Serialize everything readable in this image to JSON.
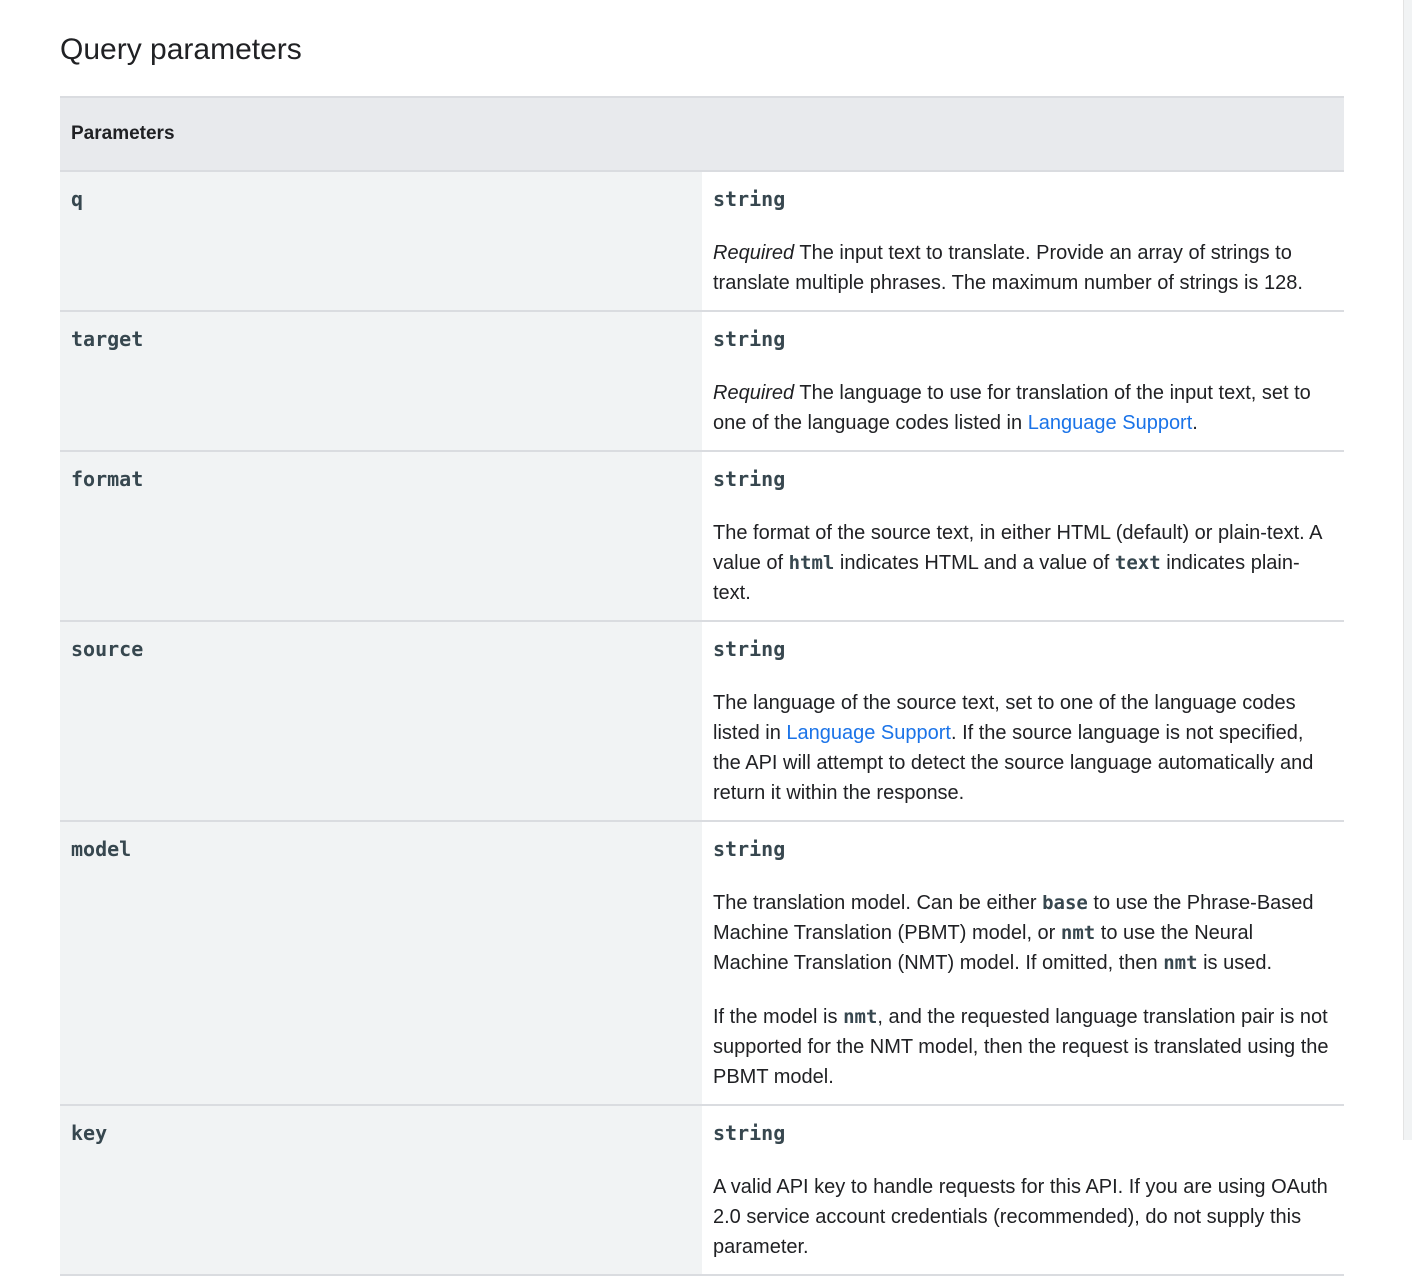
{
  "page": {
    "title": "Query parameters"
  },
  "table": {
    "header": "Parameters"
  },
  "params": {
    "q": {
      "name": "q",
      "type": "string",
      "required": "Required",
      "desc": " The input text to translate. Provide an array of strings to translate multiple phrases. The maximum number of strings is 128."
    },
    "target": {
      "name": "target",
      "type": "string",
      "required": "Required",
      "desc_1": " The language to use for translation of the input text, set to one of the language codes listed in ",
      "link": "Language Support",
      "desc_2": "."
    },
    "format": {
      "name": "format",
      "type": "string",
      "desc_1": "The format of the source text, in either HTML (default) or plain-text. A value of ",
      "code_1": "html",
      "desc_2": " indicates HTML and a value of ",
      "code_2": "text",
      "desc_3": " indicates plain-text."
    },
    "source": {
      "name": "source",
      "type": "string",
      "desc_1": "The language of the source text, set to one of the language codes listed in ",
      "link": "Language Support",
      "desc_2": ". If the source language is not specified, the API will attempt to detect the source language automatically and return it within the response."
    },
    "model": {
      "name": "model",
      "type": "string",
      "p1_1": "The translation model. Can be either ",
      "p1_code_1": "base",
      "p1_2": " to use the Phrase-Based Machine Translation (PBMT) model, or ",
      "p1_code_2": "nmt",
      "p1_3": " to use the Neural Machine Translation (NMT) model. If omitted, then ",
      "p1_code_3": "nmt",
      "p1_4": " is used.",
      "p2_1": "If the model is ",
      "p2_code_1": "nmt",
      "p2_2": ", and the requested language translation pair is not supported for the NMT model, then the request is translated using the PBMT model."
    },
    "key": {
      "name": "key",
      "type": "string",
      "desc": "A valid API key to handle requests for this API. If you are using OAuth 2.0 service account credentials (recommended), do not supply this parameter."
    }
  }
}
